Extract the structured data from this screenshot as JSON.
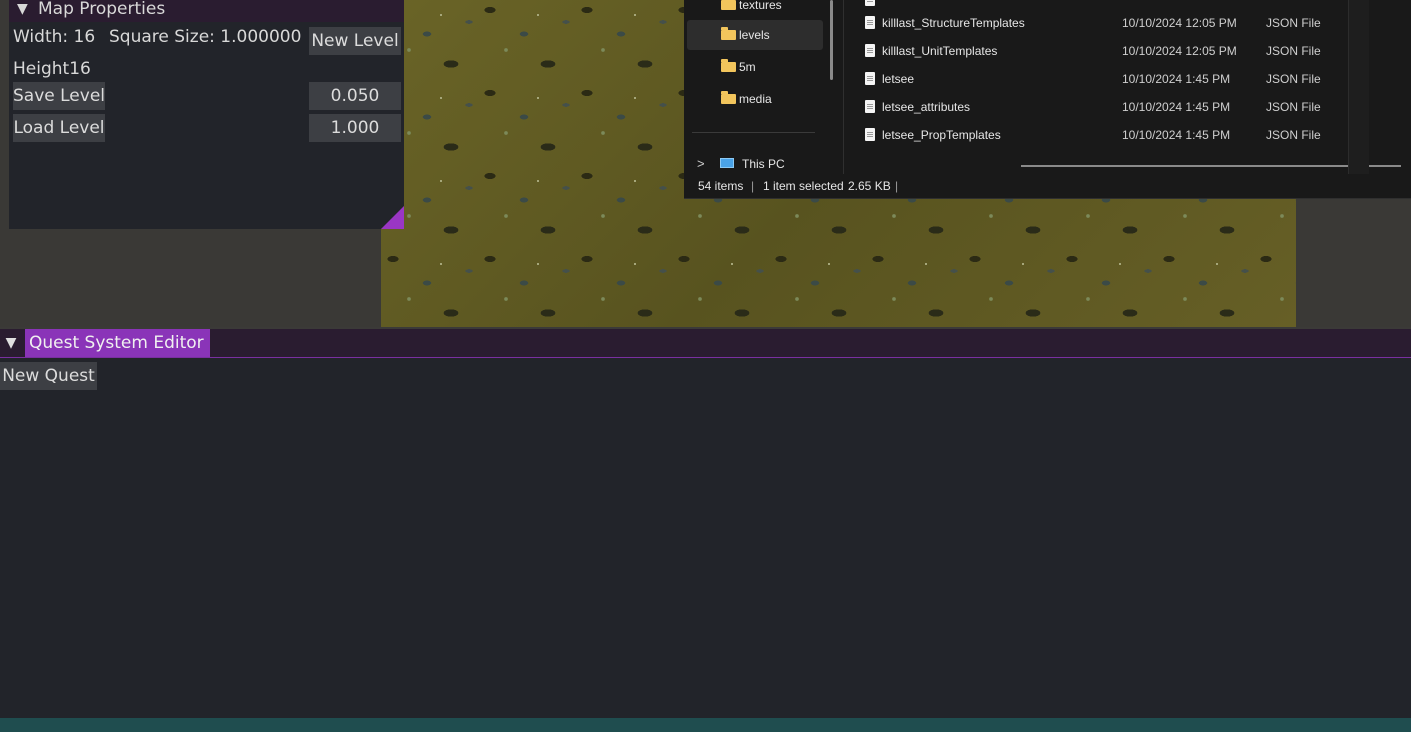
{
  "map_properties": {
    "title": "Map Properties",
    "width_label": "Width: 16",
    "square_size_label": "Square Size: 1.000000",
    "height_label": "Height16",
    "new_level_label": "New Level",
    "save_level_label": "Save Level",
    "load_level_label": "Load Level",
    "value_a": "0.050",
    "value_b": "1.000"
  },
  "explorer": {
    "nav_items": [
      {
        "label": "textures",
        "icon": "folder-icon"
      },
      {
        "label": "levels",
        "icon": "folder-icon",
        "selected": true
      },
      {
        "label": "5m",
        "icon": "folder-icon"
      },
      {
        "label": "media",
        "icon": "folder-icon"
      }
    ],
    "this_pc": "This PC",
    "files": [
      {
        "name": "killlast_StructureTemplates",
        "date": "10/10/2024 12:05 PM",
        "type": "JSON File"
      },
      {
        "name": "killlast_UnitTemplates",
        "date": "10/10/2024 12:05 PM",
        "type": "JSON File"
      },
      {
        "name": "letsee",
        "date": "10/10/2024 1:45 PM",
        "type": "JSON File"
      },
      {
        "name": "letsee_attributes",
        "date": "10/10/2024 1:45 PM",
        "type": "JSON File"
      },
      {
        "name": "letsee_PropTemplates",
        "date": "10/10/2024 1:45 PM",
        "type": "JSON File"
      }
    ],
    "status": {
      "items": "54 items",
      "selected": "1 item selected",
      "size": "2.65 KB"
    }
  },
  "quest_editor": {
    "title": "Quest System Editor",
    "new_quest_label": "New Quest"
  },
  "colors": {
    "panel_bg": "#22242a",
    "title_bg": "#2a1c30",
    "accent": "#8a34b8",
    "button_bg": "#3d3f44"
  }
}
